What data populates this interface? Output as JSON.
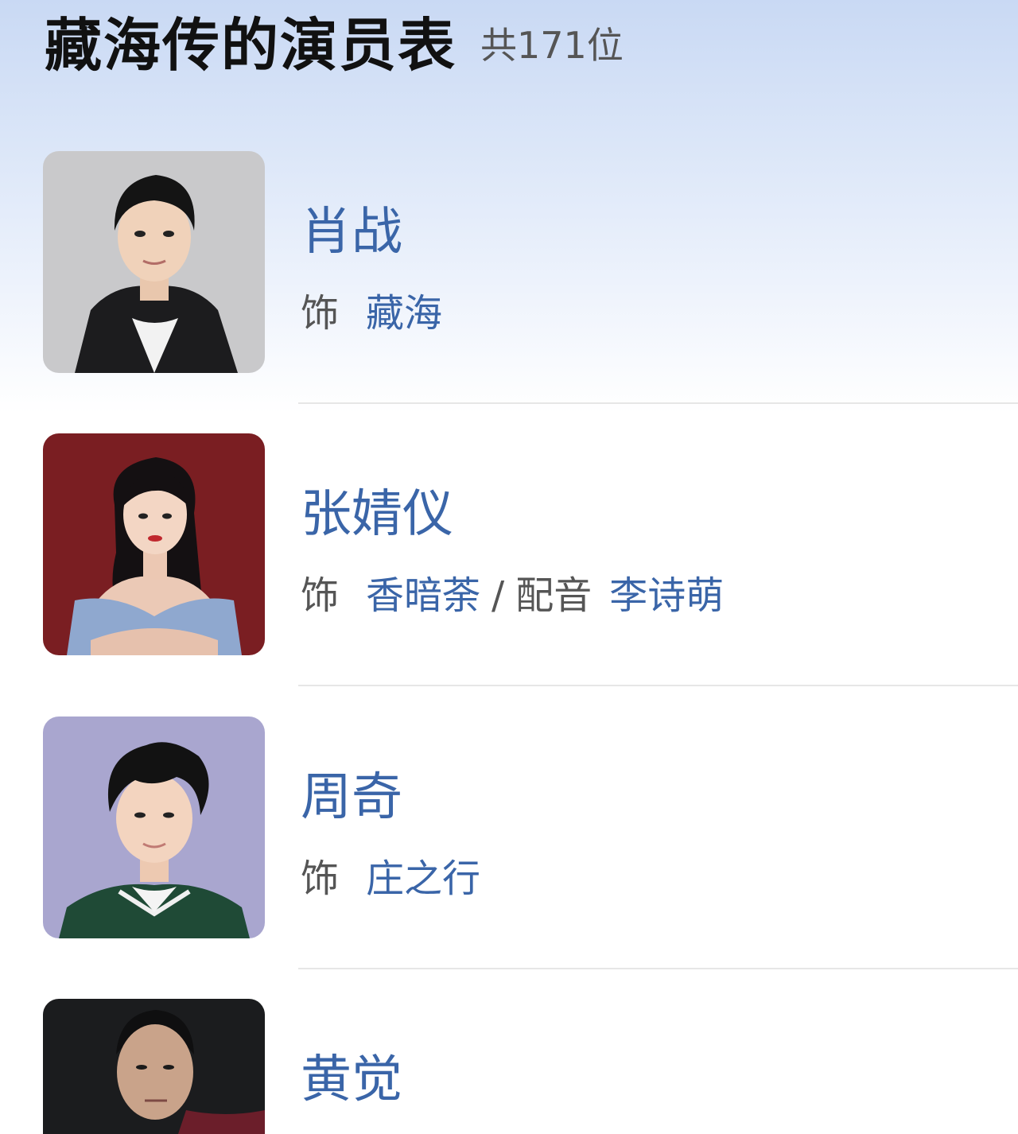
{
  "header": {
    "title": "藏海传的演员表",
    "count": "共171位"
  },
  "cast": [
    {
      "name": "肖战",
      "role_prefix": "饰",
      "role": "藏海"
    },
    {
      "name": "张婧仪",
      "role_prefix": "饰",
      "role": "香暗荼",
      "separator": "/",
      "voice_prefix": "配音",
      "voice_actor": "李诗萌"
    },
    {
      "name": "周奇",
      "role_prefix": "饰",
      "role": "庄之行"
    },
    {
      "name": "黄觉"
    }
  ],
  "colors": {
    "accent": "#3a65a8",
    "header_gradient_top": "#c9d9f4",
    "avatar_1_bg": "#c8c8ca",
    "avatar_2_bg": "#7a1e22",
    "avatar_3_bg": "#a9a6cf",
    "avatar_4_bg": "#1b1c1e"
  }
}
